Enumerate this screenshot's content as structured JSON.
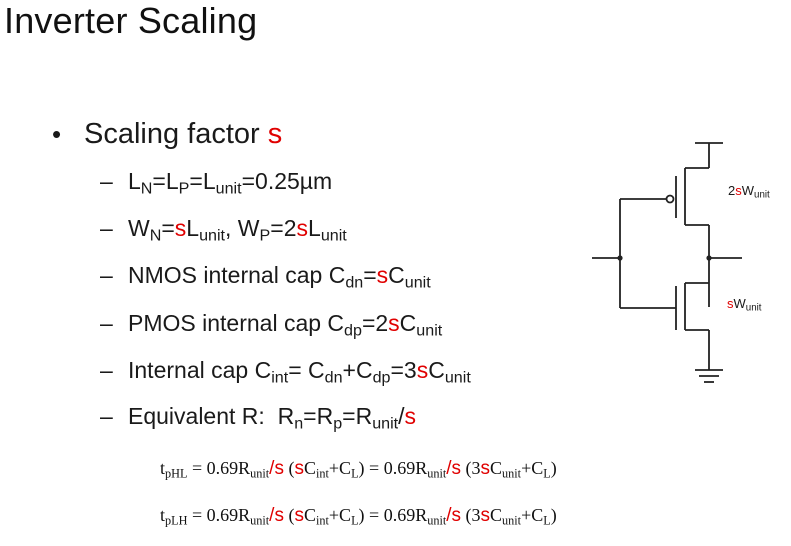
{
  "title": "Inverter Scaling",
  "bullet": {
    "text": "Scaling factor ",
    "symbol": "s"
  },
  "items": [
    {
      "id": "l",
      "parts": [
        [
          "L",
          ""
        ],
        [
          "N",
          "sub"
        ],
        [
          "=L",
          ""
        ],
        [
          "P",
          "sub"
        ],
        [
          "=L",
          ""
        ],
        [
          "unit",
          "sub"
        ],
        [
          "=0.25µm",
          ""
        ]
      ]
    },
    {
      "id": "w",
      "parts": [
        [
          "W",
          ""
        ],
        [
          "N",
          "sub"
        ],
        [
          "=",
          ""
        ],
        [
          "s",
          "red"
        ],
        [
          "L",
          ""
        ],
        [
          "unit",
          "sub"
        ],
        [
          ", W",
          ""
        ],
        [
          "P",
          "sub"
        ],
        [
          "=2",
          ""
        ],
        [
          "s",
          "red"
        ],
        [
          "L",
          ""
        ],
        [
          "unit",
          "sub"
        ]
      ]
    },
    {
      "id": "nmos",
      "parts": [
        [
          "NMOS internal cap C",
          ""
        ],
        [
          "dn",
          "sub"
        ],
        [
          "=",
          ""
        ],
        [
          "s",
          "red"
        ],
        [
          "C",
          ""
        ],
        [
          "unit",
          "sub"
        ]
      ]
    },
    {
      "id": "pmos",
      "parts": [
        [
          "PMOS internal cap C",
          ""
        ],
        [
          "dp",
          "sub"
        ],
        [
          "=2",
          ""
        ],
        [
          "s",
          "red"
        ],
        [
          "C",
          ""
        ],
        [
          "unit",
          "sub"
        ]
      ]
    },
    {
      "id": "int",
      "parts": [
        [
          "Internal cap C",
          ""
        ],
        [
          "int",
          "sub"
        ],
        [
          "= C",
          ""
        ],
        [
          "dn",
          "sub"
        ],
        [
          "+C",
          ""
        ],
        [
          "dp",
          "sub"
        ],
        [
          "=3",
          ""
        ],
        [
          "s",
          "red"
        ],
        [
          "C",
          ""
        ],
        [
          "unit",
          "sub"
        ]
      ]
    },
    {
      "id": "req",
      "parts": [
        [
          "Equivalent R:  R",
          ""
        ],
        [
          "n",
          "sub"
        ],
        [
          "=R",
          ""
        ],
        [
          "p",
          "sub"
        ],
        [
          "=R",
          ""
        ],
        [
          "unit",
          "sub"
        ],
        [
          "/",
          ""
        ],
        [
          "s",
          "red"
        ]
      ]
    }
  ],
  "equations": [
    {
      "id": "tphl",
      "parts": [
        [
          "t",
          ""
        ],
        [
          "pHL",
          "sub"
        ],
        [
          " = 0.69R",
          ""
        ],
        [
          "unit",
          "sub"
        ],
        [
          "/s",
          "red"
        ],
        [
          " (",
          ""
        ],
        [
          "s",
          "red"
        ],
        [
          "C",
          ""
        ],
        [
          "int",
          "sub"
        ],
        [
          "+C",
          ""
        ],
        [
          "L",
          "sub"
        ],
        [
          ") = 0.69R",
          ""
        ],
        [
          "unit",
          "sub"
        ],
        [
          "/s",
          "red"
        ],
        [
          " (3",
          ""
        ],
        [
          "s",
          "red"
        ],
        [
          "C",
          ""
        ],
        [
          "unit",
          "sub"
        ],
        [
          "+C",
          ""
        ],
        [
          "L",
          "sub"
        ],
        [
          ")",
          ""
        ]
      ]
    },
    {
      "id": "tplh",
      "parts": [
        [
          "t",
          ""
        ],
        [
          "pLH",
          "sub"
        ],
        [
          " = 0.69R",
          ""
        ],
        [
          "unit",
          "sub"
        ],
        [
          "/s",
          "red"
        ],
        [
          " (",
          ""
        ],
        [
          "s",
          "red"
        ],
        [
          "C",
          ""
        ],
        [
          "int",
          "sub"
        ],
        [
          "+C",
          ""
        ],
        [
          "L",
          "sub"
        ],
        [
          ") = 0.69R",
          ""
        ],
        [
          "unit",
          "sub"
        ],
        [
          "/s",
          "red"
        ],
        [
          " (3",
          ""
        ],
        [
          "s",
          "red"
        ],
        [
          "C",
          ""
        ],
        [
          "unit",
          "sub"
        ],
        [
          "+C",
          ""
        ],
        [
          "L",
          "sub"
        ],
        [
          ")",
          ""
        ]
      ]
    }
  ],
  "circuit": {
    "pmos_label": {
      "prefix": "2",
      "s": "s",
      "w": "W",
      "sub": "unit"
    },
    "nmos_label": {
      "s": "s",
      "w": "W",
      "sub": "unit"
    }
  },
  "colors": {
    "accent": "#e00000",
    "text": "#1a1a1a"
  }
}
